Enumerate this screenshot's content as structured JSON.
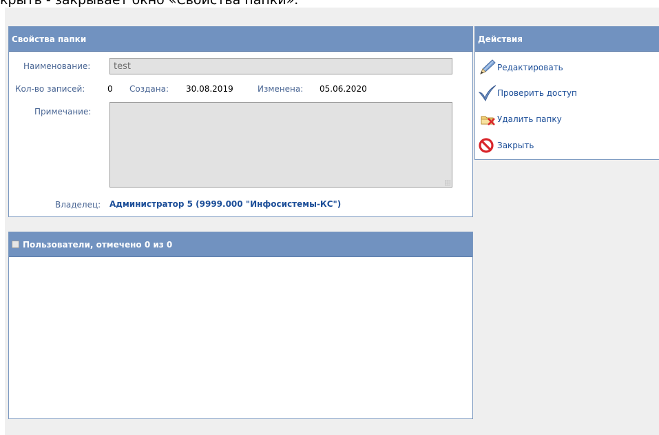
{
  "caption": "крыть - закрывает окно «Свойства папки».",
  "props": {
    "title": "Свойства папки",
    "name_label": "Наименование:",
    "name_value": "test",
    "count_label": "Кол-во записей:",
    "count_value": "0",
    "created_label": "Создана:",
    "created_value": "30.08.2019",
    "modified_label": "Изменена:",
    "modified_value": "05.06.2020",
    "note_label": "Примечание:",
    "note_value": "",
    "owner_label": "Владелец:",
    "owner_value": "Администратор 5 (9999.000 \"Инфосистемы-КС\")"
  },
  "actions": {
    "title": "Действия",
    "items": [
      {
        "label": "Редактировать",
        "icon": "pencil-icon"
      },
      {
        "label": "Проверить доступ",
        "icon": "checkmark-icon"
      },
      {
        "label": "Удалить папку",
        "icon": "delete-folder-icon"
      },
      {
        "label": "Закрыть",
        "icon": "no-entry-icon"
      }
    ]
  },
  "users": {
    "title": "Пользователи, отмечено 0 из 0"
  },
  "colors": {
    "header": "#7192c0",
    "border": "#7a98c0",
    "label": "#4a6694",
    "link": "#1c4e98",
    "workspace": "#efefef"
  }
}
